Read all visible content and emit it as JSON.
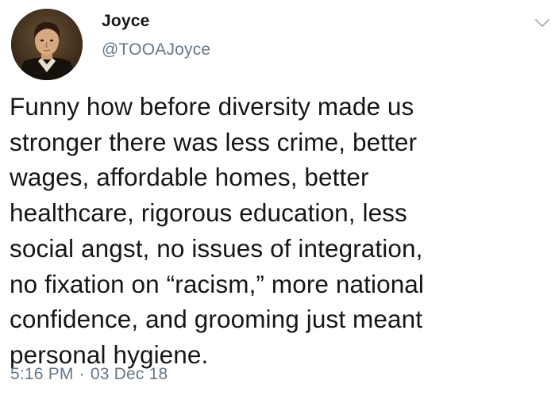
{
  "tweet": {
    "author": {
      "display_name": "Joyce",
      "handle": "@TOOAJoyce",
      "avatar_icon": "portrait-avatar"
    },
    "menu_icon": "chevron-down-icon",
    "text": "Funny how before diversity made us\nstronger there was less crime, better\nwages, affordable homes, better\nhealthcare, rigorous education, less\nsocial angst, no issues of integration,\nno fixation on “racism,” more national\nconfidence, and grooming just meant\npersonal hygiene.",
    "time": "5:16 PM",
    "separator": "·",
    "date": "03 Dec 18"
  },
  "colors": {
    "text": "#14171a",
    "secondary": "#657786",
    "background": "#ffffff"
  }
}
